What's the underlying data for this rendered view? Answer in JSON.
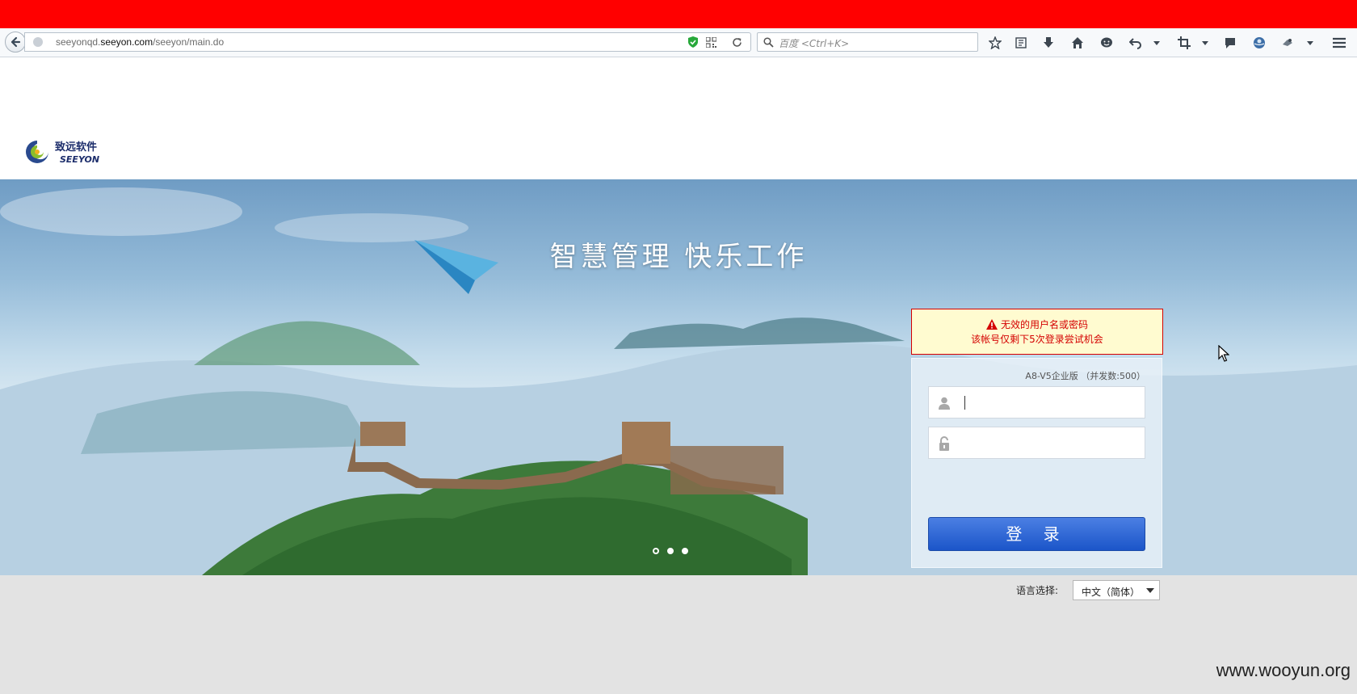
{
  "browser": {
    "url_prefix": "seeyonqd.",
    "url_host": "seeyon.com",
    "url_path": "/seeyon/main.do",
    "search_placeholder": "百度 <Ctrl+K>"
  },
  "logo": {
    "cn": "致远软件",
    "en": "SEEYON"
  },
  "banner": {
    "slogan": "智慧管理  快乐工作",
    "slides_total": 3,
    "active_slide": 1
  },
  "error": {
    "line1": "无效的用户名或密码",
    "line2": "该帐号仅剩下5次登录尝试机会"
  },
  "login": {
    "version": "A8-V5企业版 （并发数:500）",
    "username_value": "",
    "password_value": "",
    "button_label": "登 录"
  },
  "language": {
    "label": "语言选择:",
    "selected": "中文（简体）"
  },
  "watermark": "www.wooyun.org",
  "colors": {
    "titlebar": "#ff0000",
    "error_border": "#d50000",
    "error_text": "#d40000",
    "login_button": "#1b55c9"
  }
}
